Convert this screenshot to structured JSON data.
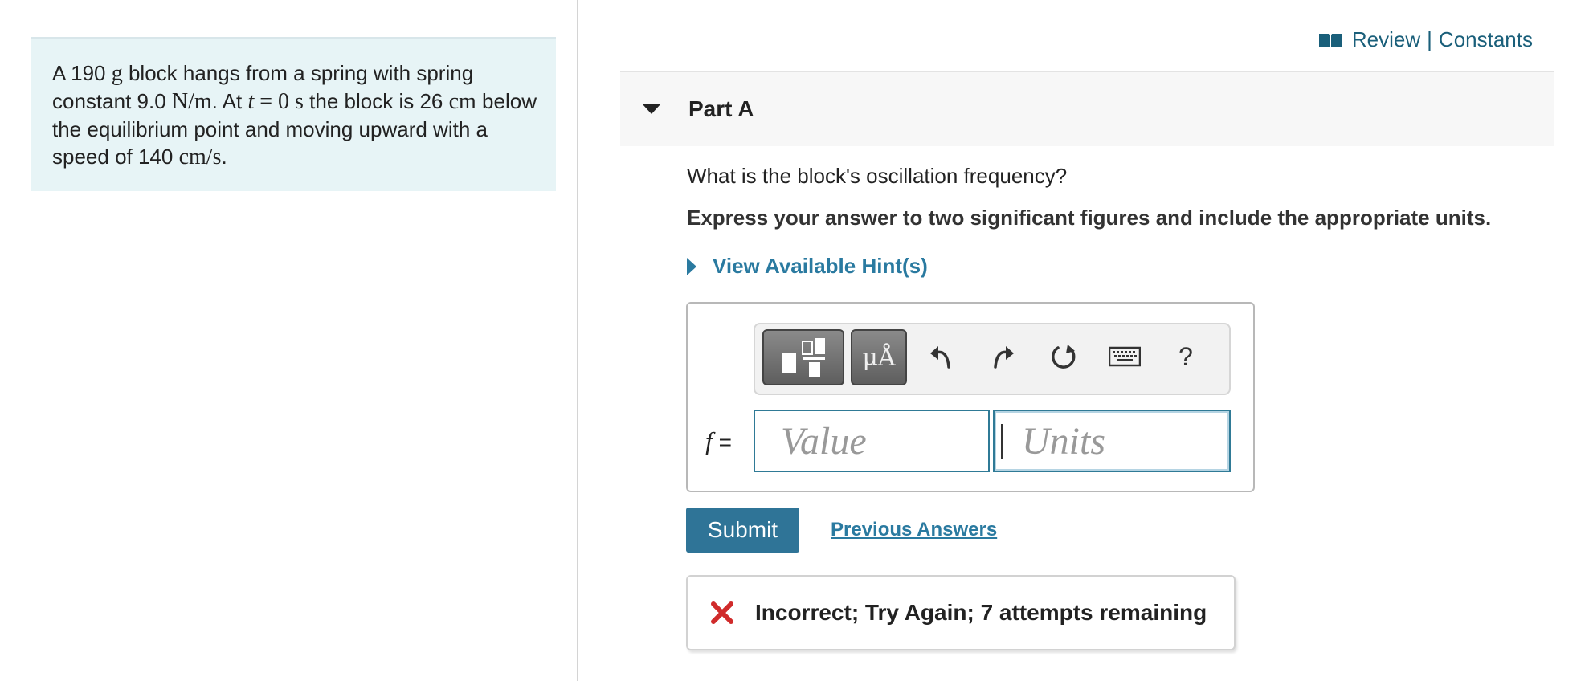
{
  "problem": {
    "t1": "A 190 ",
    "m1": "g",
    "t2": " block hangs from a spring with spring constant 9.0 ",
    "m2": "N/m",
    "t3": ". At ",
    "m3var": "t",
    "m3rest": " = 0 s",
    "t4": " the block is 26 ",
    "m4": "cm",
    "t5": " below the equilibrium point and moving upward with a speed of 140 ",
    "m5": "cm/s",
    "t6": "."
  },
  "header_links": {
    "review": "Review",
    "separator": "|",
    "constants": "Constants"
  },
  "part": {
    "title": "Part A"
  },
  "question": "What is the block's oscillation frequency?",
  "instructions": "Express your answer to two significant figures and include the appropriate units.",
  "hints_label": "View Available Hint(s)",
  "toolbar": {
    "symbols_label": "μÅ",
    "help_label": "?",
    "icons": [
      "templates-icon",
      "undo-icon",
      "redo-icon",
      "reset-icon",
      "keyboard-icon",
      "help-icon"
    ]
  },
  "answer": {
    "variable": "f",
    "equals": "=",
    "value_placeholder": "Value",
    "units_placeholder": "Units"
  },
  "submit_label": "Submit",
  "previous_answers_label": "Previous Answers",
  "feedback": {
    "text": "Incorrect; Try Again; 7 attempts remaining",
    "icon": "x-icon"
  },
  "colors": {
    "accent": "#2f7497",
    "link": "#2a7aa0",
    "problem_bg": "#e7f4f6",
    "error": "#d02b2b"
  }
}
